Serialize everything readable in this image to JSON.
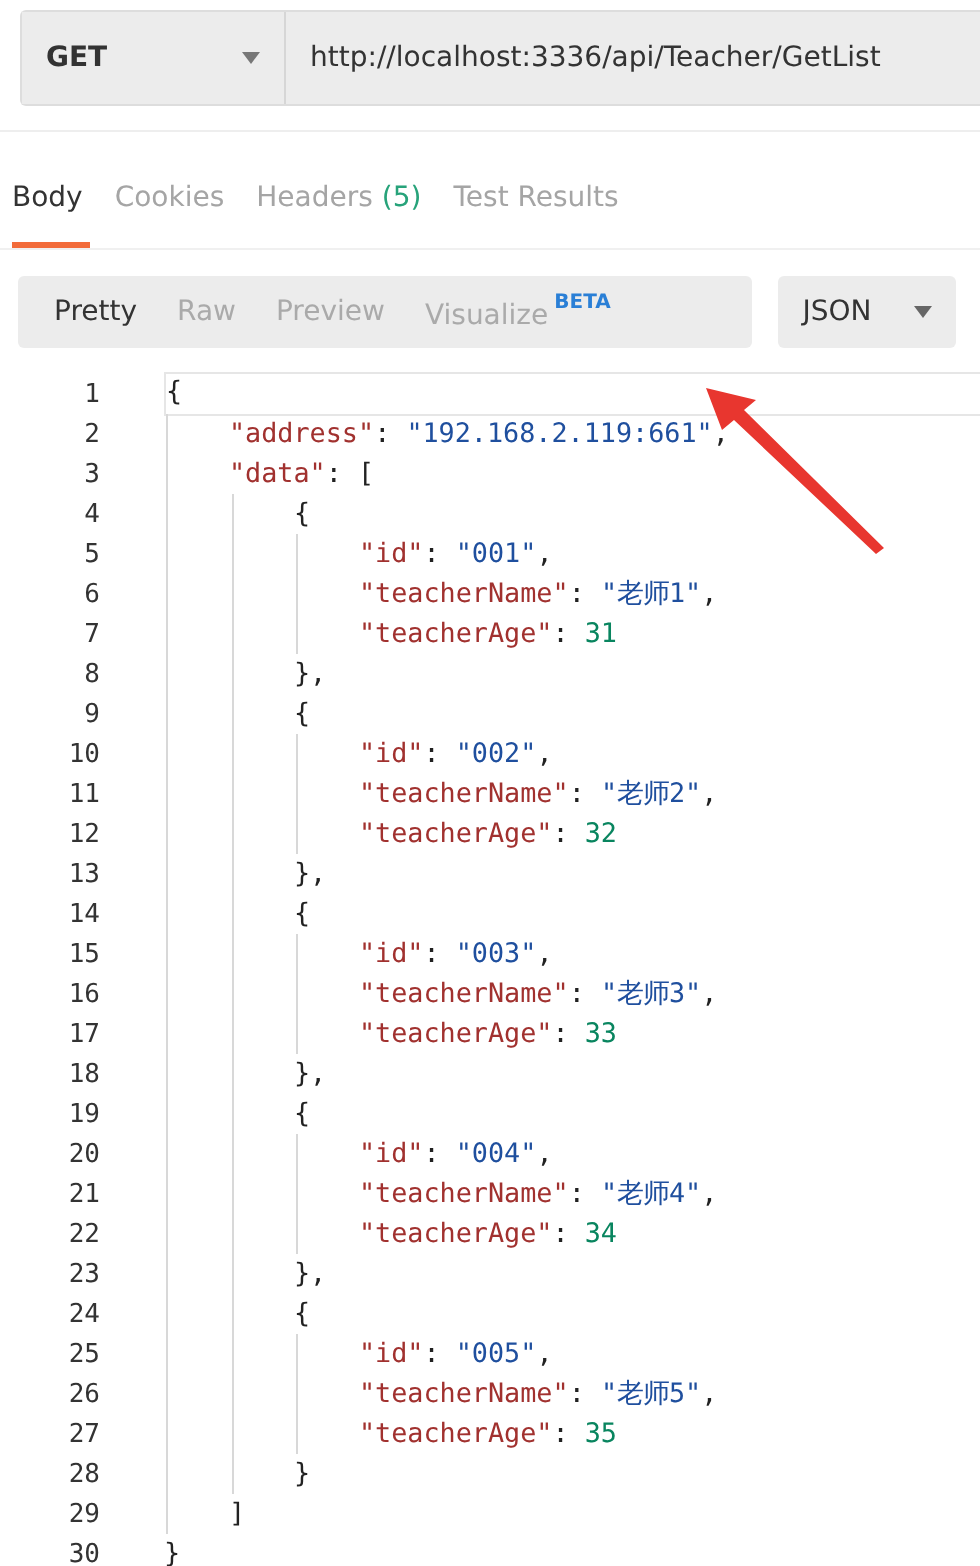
{
  "request": {
    "method": "GET",
    "url": "http://localhost:3336/api/Teacher/GetList"
  },
  "response_tabs": [
    {
      "label": "Body",
      "selected": true
    },
    {
      "label": "Cookies",
      "selected": false
    },
    {
      "label": "Headers",
      "count": "(5)",
      "selected": false
    },
    {
      "label": "Test Results",
      "selected": false
    }
  ],
  "view_modes": [
    {
      "label": "Pretty",
      "selected": true
    },
    {
      "label": "Raw",
      "selected": false
    },
    {
      "label": "Preview",
      "selected": false
    },
    {
      "label": "Visualize",
      "badge": "BETA",
      "selected": false
    }
  ],
  "format": "JSON",
  "code_lines": [
    {
      "number": "1",
      "current": true,
      "tokens": [
        {
          "kind": "punct",
          "text": "{"
        }
      ]
    },
    {
      "number": "2",
      "current": false,
      "tokens": [
        {
          "kind": "key",
          "text": "\"address\""
        },
        {
          "kind": "punct",
          "text": ": "
        },
        {
          "kind": "string",
          "text": "\"192.168.2.119:661\""
        },
        {
          "kind": "punct",
          "text": ","
        }
      ]
    },
    {
      "number": "3",
      "current": false,
      "tokens": [
        {
          "kind": "key",
          "text": "\"data\""
        },
        {
          "kind": "punct",
          "text": ": ["
        }
      ]
    },
    {
      "number": "4",
      "current": false,
      "tokens": [
        {
          "kind": "punct",
          "text": "{"
        }
      ]
    },
    {
      "number": "5",
      "current": false,
      "tokens": [
        {
          "kind": "key",
          "text": "\"id\""
        },
        {
          "kind": "punct",
          "text": ": "
        },
        {
          "kind": "string",
          "text": "\"001\""
        },
        {
          "kind": "punct",
          "text": ","
        }
      ]
    },
    {
      "number": "6",
      "current": false,
      "tokens": [
        {
          "kind": "key",
          "text": "\"teacherName\""
        },
        {
          "kind": "punct",
          "text": ": "
        },
        {
          "kind": "string",
          "text": "\"老师1\""
        },
        {
          "kind": "punct",
          "text": ","
        }
      ]
    },
    {
      "number": "7",
      "current": false,
      "tokens": [
        {
          "kind": "key",
          "text": "\"teacherAge\""
        },
        {
          "kind": "punct",
          "text": ": "
        },
        {
          "kind": "number",
          "text": "31"
        }
      ]
    },
    {
      "number": "8",
      "current": false,
      "tokens": [
        {
          "kind": "punct",
          "text": "},"
        }
      ]
    },
    {
      "number": "9",
      "current": false,
      "tokens": [
        {
          "kind": "punct",
          "text": "{"
        }
      ]
    },
    {
      "number": "10",
      "current": false,
      "tokens": [
        {
          "kind": "key",
          "text": "\"id\""
        },
        {
          "kind": "punct",
          "text": ": "
        },
        {
          "kind": "string",
          "text": "\"002\""
        },
        {
          "kind": "punct",
          "text": ","
        }
      ]
    },
    {
      "number": "11",
      "current": false,
      "tokens": [
        {
          "kind": "key",
          "text": "\"teacherName\""
        },
        {
          "kind": "punct",
          "text": ": "
        },
        {
          "kind": "string",
          "text": "\"老师2\""
        },
        {
          "kind": "punct",
          "text": ","
        }
      ]
    },
    {
      "number": "12",
      "current": false,
      "tokens": [
        {
          "kind": "key",
          "text": "\"teacherAge\""
        },
        {
          "kind": "punct",
          "text": ": "
        },
        {
          "kind": "number",
          "text": "32"
        }
      ]
    },
    {
      "number": "13",
      "current": false,
      "tokens": [
        {
          "kind": "punct",
          "text": "},"
        }
      ]
    },
    {
      "number": "14",
      "current": false,
      "tokens": [
        {
          "kind": "punct",
          "text": "{"
        }
      ]
    },
    {
      "number": "15",
      "current": false,
      "tokens": [
        {
          "kind": "key",
          "text": "\"id\""
        },
        {
          "kind": "punct",
          "text": ": "
        },
        {
          "kind": "string",
          "text": "\"003\""
        },
        {
          "kind": "punct",
          "text": ","
        }
      ]
    },
    {
      "number": "16",
      "current": false,
      "tokens": [
        {
          "kind": "key",
          "text": "\"teacherName\""
        },
        {
          "kind": "punct",
          "text": ": "
        },
        {
          "kind": "string",
          "text": "\"老师3\""
        },
        {
          "kind": "punct",
          "text": ","
        }
      ]
    },
    {
      "number": "17",
      "current": false,
      "tokens": [
        {
          "kind": "key",
          "text": "\"teacherAge\""
        },
        {
          "kind": "punct",
          "text": ": "
        },
        {
          "kind": "number",
          "text": "33"
        }
      ]
    },
    {
      "number": "18",
      "current": false,
      "tokens": [
        {
          "kind": "punct",
          "text": "},"
        }
      ]
    },
    {
      "number": "19",
      "current": false,
      "tokens": [
        {
          "kind": "punct",
          "text": "{"
        }
      ]
    },
    {
      "number": "20",
      "current": false,
      "tokens": [
        {
          "kind": "key",
          "text": "\"id\""
        },
        {
          "kind": "punct",
          "text": ": "
        },
        {
          "kind": "string",
          "text": "\"004\""
        },
        {
          "kind": "punct",
          "text": ","
        }
      ]
    },
    {
      "number": "21",
      "current": false,
      "tokens": [
        {
          "kind": "key",
          "text": "\"teacherName\""
        },
        {
          "kind": "punct",
          "text": ": "
        },
        {
          "kind": "string",
          "text": "\"老师4\""
        },
        {
          "kind": "punct",
          "text": ","
        }
      ]
    },
    {
      "number": "22",
      "current": false,
      "tokens": [
        {
          "kind": "key",
          "text": "\"teacherAge\""
        },
        {
          "kind": "punct",
          "text": ": "
        },
        {
          "kind": "number",
          "text": "34"
        }
      ]
    },
    {
      "number": "23",
      "current": false,
      "tokens": [
        {
          "kind": "punct",
          "text": "},"
        }
      ]
    },
    {
      "number": "24",
      "current": false,
      "tokens": [
        {
          "kind": "punct",
          "text": "{"
        }
      ]
    },
    {
      "number": "25",
      "current": false,
      "tokens": [
        {
          "kind": "key",
          "text": "\"id\""
        },
        {
          "kind": "punct",
          "text": ": "
        },
        {
          "kind": "string",
          "text": "\"005\""
        },
        {
          "kind": "punct",
          "text": ","
        }
      ]
    },
    {
      "number": "26",
      "current": false,
      "tokens": [
        {
          "kind": "key",
          "text": "\"teacherName\""
        },
        {
          "kind": "punct",
          "text": ": "
        },
        {
          "kind": "string",
          "text": "\"老师5\""
        },
        {
          "kind": "punct",
          "text": ","
        }
      ]
    },
    {
      "number": "27",
      "current": false,
      "tokens": [
        {
          "kind": "key",
          "text": "\"teacherAge\""
        },
        {
          "kind": "punct",
          "text": ": "
        },
        {
          "kind": "number",
          "text": "35"
        }
      ]
    },
    {
      "number": "28",
      "current": false,
      "tokens": [
        {
          "kind": "punct",
          "text": "}"
        }
      ]
    },
    {
      "number": "29",
      "current": false,
      "tokens": [
        {
          "kind": "punct",
          "text": "]"
        }
      ]
    },
    {
      "number": "30",
      "current": false,
      "tokens": [
        {
          "kind": "punct",
          "text": "}"
        }
      ]
    }
  ]
}
